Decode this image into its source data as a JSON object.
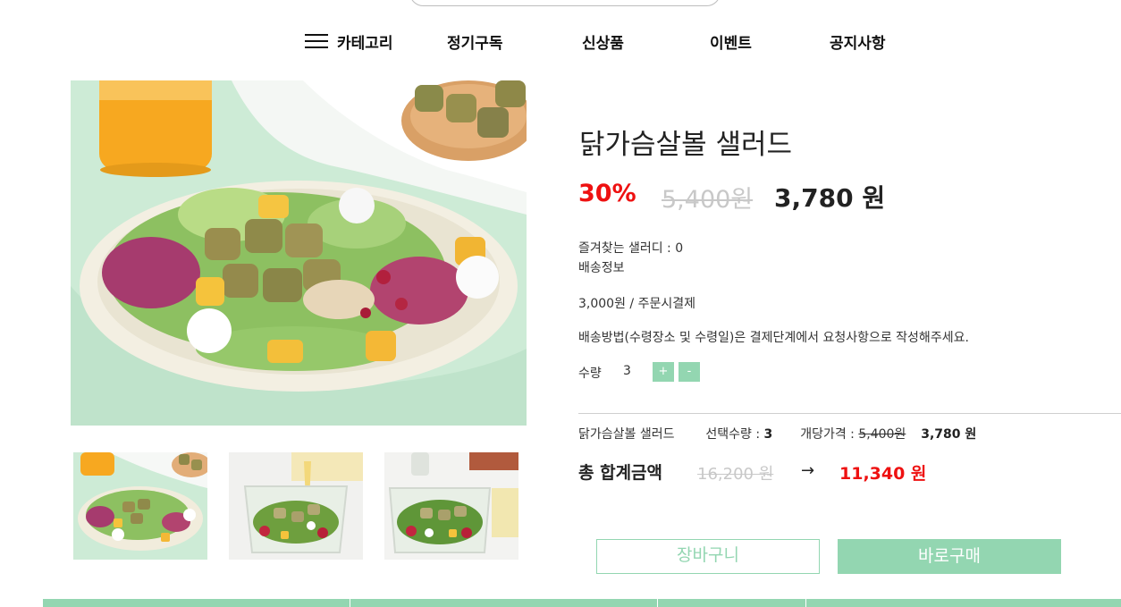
{
  "nav": {
    "category_label": "카테고리",
    "items": [
      "정기구독",
      "신상품",
      "이벤트",
      "공지사항"
    ]
  },
  "product": {
    "title": "닭가슴살볼 샐러드",
    "discount": "30%",
    "original_price": "5,400원",
    "sale_price": "3,780 원"
  },
  "info": {
    "favorites": "즐겨찾는 샐러디 : 0",
    "shipping_title": "배송정보",
    "shipping_fee": "3,000원 / 주문시결제",
    "shipping_note": "배송방법(수령장소 및 수령일)은 결제단계에서 요청사항으로 작성해주세요."
  },
  "quantity": {
    "label": "수량",
    "value": "3",
    "plus": "+",
    "minus": "-"
  },
  "summary": {
    "name": "닭가슴살볼 샐러드",
    "selected_label": "선택수량 : ",
    "selected_value": "3",
    "unit_label": "개당가격 : ",
    "unit_orig": "5,400원",
    "unit_sale": "3,780 원"
  },
  "total": {
    "label": "총 합계금액",
    "original": "16,200 원",
    "arrow": "→",
    "final": "11,340 원"
  },
  "buttons": {
    "cart": "장바구니",
    "buy": "바로구매"
  },
  "colors": {
    "accent": "#93d6b1",
    "discount": "#ee1111",
    "muted": "#c8c8c8"
  }
}
